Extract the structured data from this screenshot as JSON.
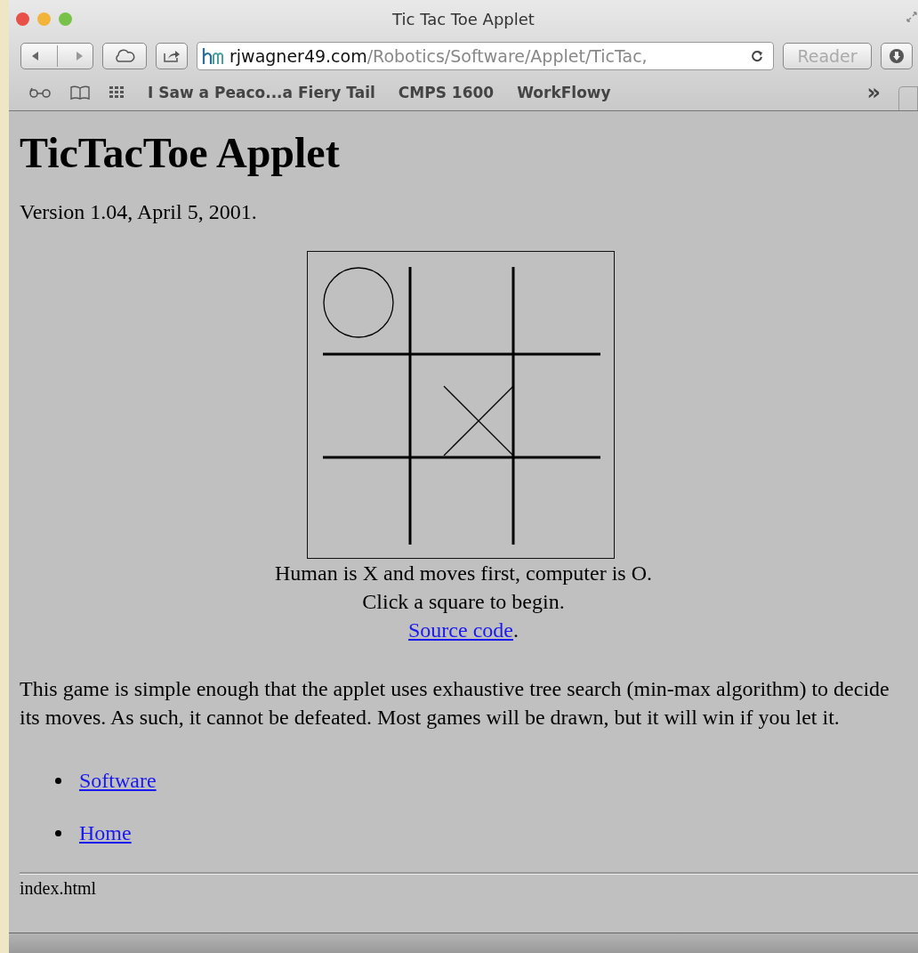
{
  "window": {
    "title": "Tic Tac Toe Applet"
  },
  "toolbar": {
    "url_domain": "rjwagner49.com",
    "url_path": "/Robotics/Software/Applet/TicTac,",
    "reader_button": "Reader"
  },
  "bookmarks": [
    {
      "label": "I Saw a Peaco...a Fiery Tail"
    },
    {
      "label": "CMPS 1600"
    },
    {
      "label": "WorkFlowy"
    }
  ],
  "bookmarks_overflow": "»",
  "page": {
    "heading": "TicTacToe Applet",
    "version": "Version 1.04, April 5, 2001.",
    "board": {
      "cells": [
        {
          "kind": "o"
        },
        {
          "kind": "empty"
        },
        {
          "kind": "empty"
        },
        {
          "kind": "empty"
        },
        {
          "kind": "x"
        },
        {
          "kind": "empty"
        },
        {
          "kind": "empty"
        },
        {
          "kind": "empty"
        },
        {
          "kind": "empty"
        }
      ]
    },
    "caption_lines": [
      "Human is X and moves first, computer is O.",
      "Click a square to begin."
    ],
    "source_link": "Source code",
    "source_suffix": ".",
    "paragraph": "This game is simple enough that the applet uses exhaustive tree search (min-max algorithm) to decide its moves. As such, it cannot be defeated. Most games will be drawn, but it will win if you let it.",
    "links": [
      "Software",
      "Home"
    ],
    "footer": "index.html"
  }
}
